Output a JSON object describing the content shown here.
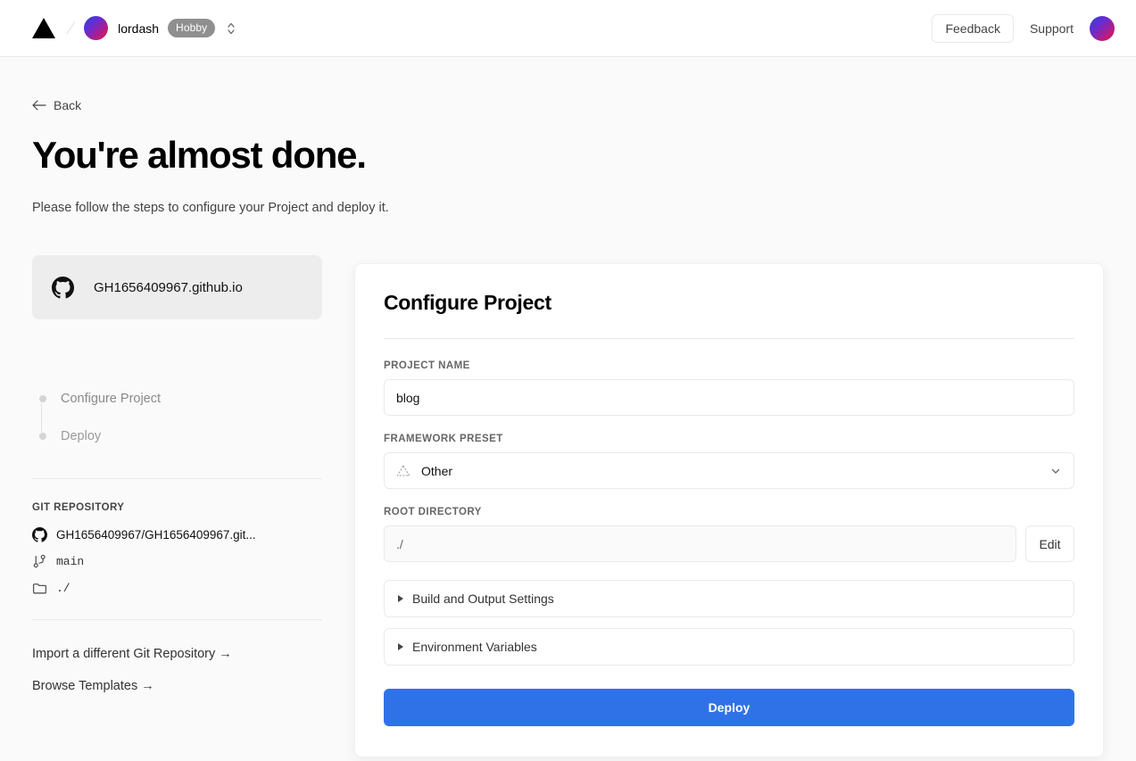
{
  "header": {
    "logo_icon": "vercel-triangle-icon",
    "team_name": "lordash",
    "plan_badge": "Hobby",
    "switcher_icon": "chevron-up-down-icon",
    "feedback_label": "Feedback",
    "support_label": "Support",
    "user_avatar": "user-avatar"
  },
  "page": {
    "back_label": "Back",
    "back_icon": "arrow-left-icon",
    "title": "You're almost done.",
    "subtitle": "Please follow the steps to configure your Project and deploy it."
  },
  "sidebar": {
    "repo_card": {
      "icon": "github-icon",
      "name": "GH1656409967.github.io"
    },
    "steps": [
      {
        "label": "Configure Project"
      },
      {
        "label": "Deploy"
      }
    ],
    "git": {
      "heading": "GIT REPOSITORY",
      "repo_icon": "github-icon",
      "repo": "GH1656409967/GH1656409967.git...",
      "branch_icon": "git-branch-icon",
      "branch": "main",
      "folder_icon": "folder-icon",
      "directory": "./"
    },
    "links": [
      {
        "label": "Import a different Git Repository →"
      },
      {
        "label": "Browse Templates →"
      }
    ]
  },
  "configure": {
    "title": "Configure Project",
    "project_name": {
      "label": "PROJECT NAME",
      "value": "blog",
      "placeholder": "Project Name"
    },
    "framework": {
      "label": "FRAMEWORK PRESET",
      "icon": "other-framework-triangle-icon",
      "value": "Other",
      "chevron_icon": "chevron-down-icon"
    },
    "root_directory": {
      "label": "ROOT DIRECTORY",
      "value": "./",
      "placeholder": "./",
      "edit_label": "Edit"
    },
    "accordions": [
      {
        "label": "Build and Output Settings",
        "caret_icon": "caret-right-icon"
      },
      {
        "label": "Environment Variables",
        "caret_icon": "caret-right-icon"
      }
    ],
    "deploy_label": "Deploy",
    "accent_color": "#2f72e8"
  }
}
